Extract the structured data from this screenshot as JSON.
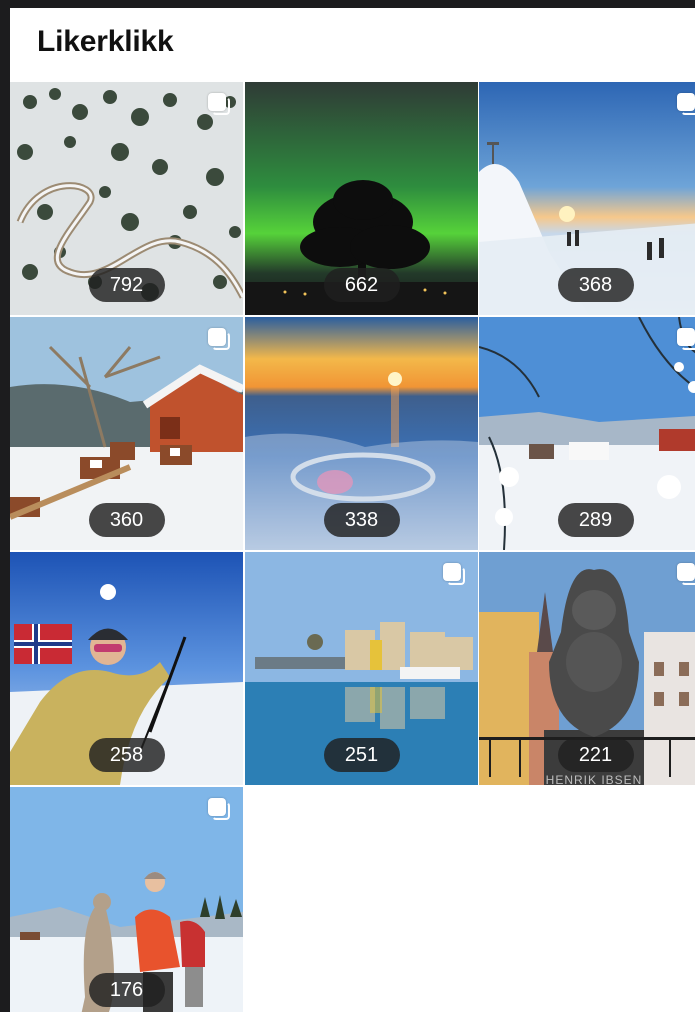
{
  "header": {
    "title": "Likerklikk"
  },
  "colors": {
    "frame": "#ffffff",
    "outside": "#1c1c1e",
    "badge": "#202020"
  },
  "tiles": [
    {
      "likes": "792",
      "multi": true,
      "scene": "aerial-winter-road-forest"
    },
    {
      "likes": "662",
      "multi": false,
      "scene": "northern-lights-tree"
    },
    {
      "likes": "368",
      "multi": true,
      "scene": "mountain-sunset-skiers"
    },
    {
      "likes": "360",
      "multi": true,
      "scene": "farm-cows-snow"
    },
    {
      "likes": "338",
      "multi": false,
      "scene": "frozen-lake-sunset"
    },
    {
      "likes": "289",
      "multi": true,
      "scene": "winter-village-trees"
    },
    {
      "likes": "258",
      "multi": false,
      "scene": "selfie-norwegian-flag"
    },
    {
      "likes": "251",
      "multi": true,
      "scene": "harbor-reflection"
    },
    {
      "likes": "221",
      "multi": true,
      "scene": "henrik-ibsen-statue"
    },
    {
      "likes": "176",
      "multi": true,
      "scene": "alpaca-walk-snow"
    }
  ],
  "ibsen_plaque": "HENRIK IBSEN"
}
